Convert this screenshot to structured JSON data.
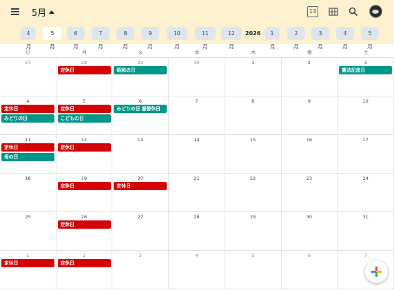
{
  "header": {
    "month_title": "5月",
    "day_view_label": "13",
    "icons": [
      "menu-icon",
      "calendar-day-icon",
      "grid-view-icon",
      "search-icon",
      "avatar"
    ]
  },
  "month_strip": {
    "before_year": [
      "4月",
      "5月",
      "6月",
      "7月",
      "8月",
      "9月",
      "10月",
      "11月",
      "12月"
    ],
    "active_index": 1,
    "year": "2026",
    "after_year": [
      "1月",
      "2月",
      "3月",
      "4月",
      "5月"
    ]
  },
  "weekdays": [
    "日",
    "月",
    "火",
    "水",
    "木",
    "金",
    "土"
  ],
  "weeks": [
    {
      "days": [
        "27",
        "28",
        "29",
        "30",
        "1",
        "2",
        "3"
      ]
    },
    {
      "days": [
        "4",
        "5",
        "6",
        "7",
        "8",
        "9",
        "10"
      ]
    },
    {
      "days": [
        "11",
        "12",
        "13",
        "14",
        "15",
        "16",
        "17"
      ]
    },
    {
      "days": [
        "18",
        "19",
        "20",
        "21",
        "22",
        "23",
        "24"
      ]
    },
    {
      "days": [
        "25",
        "26",
        "27",
        "28",
        "29",
        "30",
        "31"
      ]
    },
    {
      "days": [
        "1",
        "2",
        "3",
        "4",
        "5",
        "6",
        "7"
      ]
    }
  ],
  "events": [
    {
      "week": 0,
      "day": 1,
      "slot": 0,
      "title": "定休日",
      "color": "red"
    },
    {
      "week": 0,
      "day": 2,
      "slot": 0,
      "title": "昭和の日",
      "color": "teal"
    },
    {
      "week": 0,
      "day": 6,
      "slot": 0,
      "title": "憲法記念日",
      "color": "teal"
    },
    {
      "week": 1,
      "day": 0,
      "slot": 0,
      "title": "定休日",
      "color": "red"
    },
    {
      "week": 1,
      "day": 0,
      "slot": 1,
      "title": "みどりの日",
      "color": "teal"
    },
    {
      "week": 1,
      "day": 1,
      "slot": 0,
      "title": "定休日",
      "color": "red"
    },
    {
      "week": 1,
      "day": 1,
      "slot": 1,
      "title": "こどもの日",
      "color": "teal"
    },
    {
      "week": 1,
      "day": 2,
      "slot": 0,
      "title": "みどりの日 振替休日",
      "color": "teal"
    },
    {
      "week": 2,
      "day": 0,
      "slot": 0,
      "title": "定休日",
      "color": "red"
    },
    {
      "week": 2,
      "day": 0,
      "slot": 1,
      "title": "母の日",
      "color": "teal"
    },
    {
      "week": 2,
      "day": 1,
      "slot": 0,
      "title": "定休日",
      "color": "red"
    },
    {
      "week": 3,
      "day": 1,
      "slot": 0,
      "title": "定休日",
      "color": "red"
    },
    {
      "week": 3,
      "day": 2,
      "slot": 0,
      "title": "定休日",
      "color": "red"
    },
    {
      "week": 4,
      "day": 1,
      "slot": 0,
      "title": "定休日",
      "color": "red"
    },
    {
      "week": 5,
      "day": 0,
      "slot": 0,
      "title": "定休日",
      "color": "red"
    },
    {
      "week": 5,
      "day": 1,
      "slot": 0,
      "title": "定休日",
      "color": "red"
    }
  ],
  "colors": {
    "red": "#d50000",
    "teal": "#009688",
    "header_bg": "#fdf1cf"
  },
  "fab_icon": "plus-icon"
}
